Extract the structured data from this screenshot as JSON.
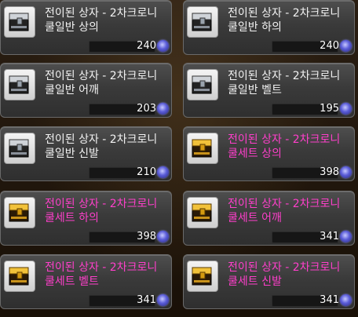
{
  "items": [
    {
      "title": "전이된 상자 - 2차크로니",
      "subtitle": "쿨일반 상의",
      "price": "240",
      "variant": "white",
      "icon": "silver-treasure-box-icon"
    },
    {
      "title": "전이된 상자 - 2차크로니",
      "subtitle": "쿨일반 하의",
      "price": "240",
      "variant": "white",
      "icon": "silver-treasure-box-icon"
    },
    {
      "title": "전이된 상자 - 2차크로니",
      "subtitle": "쿨일반 어깨",
      "price": "203",
      "variant": "white",
      "icon": "silver-treasure-box-icon"
    },
    {
      "title": "전이된 상자 - 2차크로니",
      "subtitle": "쿨일반 벨트",
      "price": "195",
      "variant": "white",
      "icon": "silver-treasure-box-icon"
    },
    {
      "title": "전이된 상자 - 2차크로니",
      "subtitle": "쿨일반 신발",
      "price": "210",
      "variant": "white",
      "icon": "silver-treasure-box-icon"
    },
    {
      "title": "전이된 상자 - 2차크로니",
      "subtitle": "쿨세트 상의",
      "price": "398",
      "variant": "pink",
      "icon": "gold-treasure-box-icon"
    },
    {
      "title": "전이된 상자 - 2차크로니",
      "subtitle": "쿨세트 하의",
      "price": "398",
      "variant": "pink",
      "icon": "gold-treasure-box-icon"
    },
    {
      "title": "전이된 상자 - 2차크로니",
      "subtitle": "쿨세트 어깨",
      "price": "341",
      "variant": "pink",
      "icon": "gold-treasure-box-icon"
    },
    {
      "title": "전이된 상자 - 2차크로니",
      "subtitle": "쿨세트 벨트",
      "price": "341",
      "variant": "pink",
      "icon": "gold-treasure-box-icon"
    },
    {
      "title": "전이된 상자 - 2차크로니",
      "subtitle": "쿨세트 신발",
      "price": "341",
      "variant": "pink",
      "icon": "gold-treasure-box-icon"
    }
  ],
  "currency_icon": "crystal-orb-icon",
  "colors": {
    "normal_text": "#f2f2f2",
    "set_text": "#ff3fcb",
    "card_bg": "#3a3a3a",
    "price_text": "#ffffff"
  }
}
